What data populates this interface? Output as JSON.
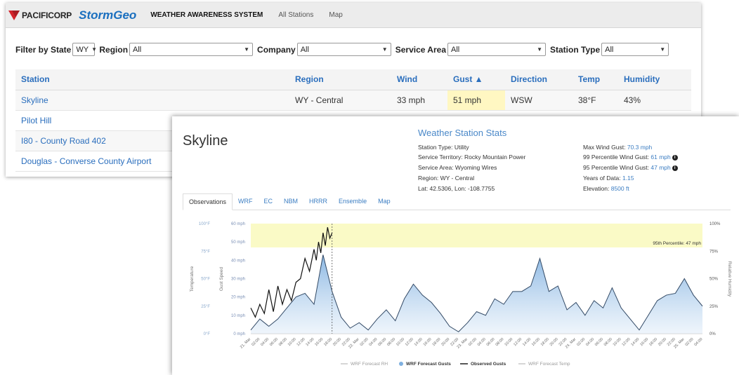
{
  "nav": {
    "brand": "PACIFICORP",
    "brand_secondary": "StormGeo",
    "system_title": "WEATHER AWARENESS SYSTEM",
    "links": [
      "All Stations",
      "Map"
    ]
  },
  "filters": {
    "state_label": "Filter by State",
    "state_value": "WY",
    "region_label": "Region",
    "region_value": "All",
    "company_label": "Company",
    "company_value": "All",
    "service_area_label": "Service Area",
    "service_area_value": "All",
    "station_type_label": "Station Type",
    "station_type_value": "All"
  },
  "table": {
    "headers": [
      "Station",
      "Region",
      "Wind",
      "Gust ▲",
      "Direction",
      "Temp",
      "Humidity"
    ],
    "rows": [
      [
        "Skyline",
        "WY - Central",
        "33 mph",
        "51 mph",
        "WSW",
        "38°F",
        "43%"
      ],
      [
        "Pilot Hill",
        "",
        "",
        "",
        "",
        "",
        ""
      ],
      [
        "I80 - County Road 402",
        "",
        "",
        "",
        "",
        "",
        ""
      ],
      [
        "Douglas - Converse County Airport",
        "",
        "",
        "",
        "",
        "",
        ""
      ]
    ]
  },
  "station": {
    "name": "Skyline",
    "stats_title": "Weather Station Stats",
    "left": [
      "Station Type: Utility",
      "Service Territory: Rocky Mountain Power",
      "Service Area: Wyoming Wires",
      "Region: WY - Central",
      "Lat: 42.5306, Lon: -108.7755"
    ],
    "right": {
      "max_gust_label": "Max Wind Gust:",
      "max_gust_value": "70.3 mph",
      "p99_label": "99 Percentile Wind Gust:",
      "p99_value": "61 mph",
      "p95_label": "95 Percentile Wind Gust:",
      "p95_value": "47 mph",
      "years_label": "Years of Data:",
      "years_value": "1.15",
      "elev_label": "Elevation:",
      "elev_value": "8500 ft"
    }
  },
  "tabs": [
    "Observations",
    "WRF",
    "EC",
    "NBM",
    "HRRR",
    "Ensemble",
    "Map"
  ],
  "colors": {
    "accent": "#3b7dc2",
    "band": "#fafac6",
    "area": "#a9c9ea",
    "highlight": "#fff7c2"
  },
  "chart_data": {
    "type": "area",
    "y_left_temp_label": "Temperature",
    "y_left_gust_label": "Gust Speed",
    "y_right_label": "Relative Humidity",
    "temp_ticks": [
      "100°F",
      "75°F",
      "50°F",
      "25°F",
      "0°F"
    ],
    "gust_ticks": [
      "60 mph",
      "50 mph",
      "40 mph",
      "30 mph",
      "20 mph",
      "10 mph",
      "0 mph"
    ],
    "rh_ticks": [
      "100%",
      "75%",
      "50%",
      "25%",
      "0%"
    ],
    "gust_ylim": [
      0,
      60
    ],
    "band": {
      "from": 47,
      "to": 60,
      "label": "95th Percentile: 47 mph"
    },
    "x_ticks": [
      "21. Mar",
      "02:00",
      "04:00",
      "06:00",
      "08:00",
      "10:00",
      "12:00",
      "14:00",
      "16:00",
      "18:00",
      "20:00",
      "22:00",
      "22. Mar",
      "02:00",
      "04:00",
      "06:00",
      "08:00",
      "10:00",
      "12:00",
      "14:00",
      "16:00",
      "18:00",
      "20:00",
      "22:00",
      "23. Mar",
      "02:00",
      "04:00",
      "06:00",
      "08:00",
      "10:00",
      "12:00",
      "14:00",
      "16:00",
      "18:00",
      "20:00",
      "22:00",
      "24. Mar",
      "02:00",
      "04:00",
      "06:00",
      "08:00",
      "10:00",
      "12:00",
      "14:00",
      "16:00",
      "18:00",
      "20:00",
      "22:00",
      "25. Mar",
      "02:00",
      "04:00"
    ],
    "hours_per_tick": 2,
    "wrf_forecast_gusts": {
      "hours": [
        0,
        2,
        4,
        6,
        8,
        10,
        12,
        14,
        16,
        18,
        20,
        22,
        24,
        26,
        28,
        30,
        32,
        34,
        36,
        38,
        40,
        42,
        44,
        46,
        48,
        50,
        52,
        54,
        56,
        58,
        60,
        62,
        64,
        66,
        68,
        70,
        72,
        74,
        76,
        78,
        80,
        82,
        84,
        86,
        88,
        90,
        92,
        94,
        96,
        98,
        100
      ],
      "values": [
        2,
        8,
        4,
        8,
        14,
        20,
        22,
        16,
        43,
        23,
        9,
        3,
        6,
        2,
        8,
        13,
        7,
        19,
        27,
        21,
        17,
        11,
        4,
        1,
        6,
        12,
        10,
        19,
        16,
        23,
        23,
        26,
        41,
        23,
        26,
        13,
        17,
        10,
        18,
        14,
        25,
        14,
        8,
        2,
        10,
        18,
        21,
        22,
        30,
        21,
        15
      ]
    },
    "observed_gusts": {
      "hours": [
        0,
        1,
        2,
        3,
        4,
        5,
        6,
        7,
        8,
        9,
        10,
        11,
        12,
        13,
        14,
        14.5,
        15,
        15.5,
        16,
        16.5,
        17,
        17.5,
        18
      ],
      "values": [
        14,
        9,
        16,
        11,
        24,
        12,
        26,
        16,
        24,
        18,
        28,
        30,
        41,
        34,
        46,
        40,
        50,
        44,
        55,
        48,
        58,
        52,
        55
      ]
    },
    "observed_until_hour": 18,
    "legend": [
      "WRF Forecast RH",
      "WRF Forecast Gusts",
      "Observed Gusts",
      "WRF Forecast Temp"
    ]
  }
}
